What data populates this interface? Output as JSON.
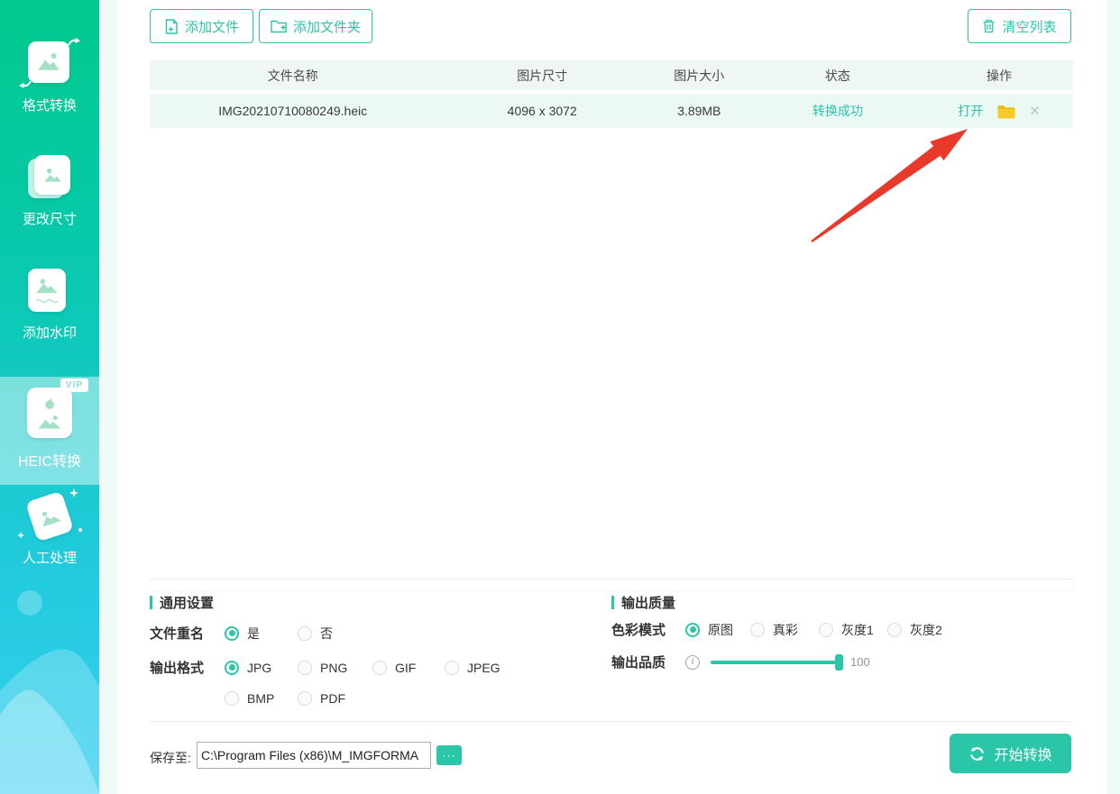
{
  "accent_color": "#2bc5a8",
  "folder_icon_color": "#f3c41f",
  "arrow_color": "#e8392b",
  "sidebar": {
    "items": [
      {
        "label": "格式转换",
        "icon": "format-convert-icon",
        "active": false
      },
      {
        "label": "更改尺寸",
        "icon": "resize-icon",
        "active": false
      },
      {
        "label": "添加水印",
        "icon": "watermark-icon",
        "active": false
      },
      {
        "label": "HEIC转换",
        "icon": "heic-convert-icon",
        "active": true,
        "badge": "VIP"
      },
      {
        "label": "人工处理",
        "icon": "manual-process-icon",
        "active": false
      }
    ]
  },
  "toolbar": {
    "add_file_label": "添加文件",
    "add_folder_label": "添加文件夹",
    "clear_list_label": "清空列表"
  },
  "table": {
    "headers": {
      "name": "文件名称",
      "dimensions": "图片尺寸",
      "size": "图片大小",
      "status": "状态",
      "operation": "操作"
    },
    "rows": [
      {
        "name": "IMG20210710080249.heic",
        "dimensions": "4096 x 3072",
        "size": "3.89MB",
        "status": "转换成功",
        "open_label": "打开"
      }
    ]
  },
  "settings": {
    "general": {
      "title": "通用设置",
      "rename_label": "文件重名",
      "rename_options": [
        {
          "label": "是",
          "selected": true
        },
        {
          "label": "否",
          "selected": false
        }
      ],
      "format_label": "输出格式",
      "format_options": [
        {
          "label": "JPG",
          "selected": true
        },
        {
          "label": "PNG",
          "selected": false
        },
        {
          "label": "GIF",
          "selected": false
        },
        {
          "label": "JPEG",
          "selected": false
        },
        {
          "label": "BMP",
          "selected": false
        },
        {
          "label": "PDF",
          "selected": false
        }
      ]
    },
    "quality": {
      "title": "输出质量",
      "color_mode_label": "色彩模式",
      "color_options": [
        {
          "label": "原图",
          "selected": true
        },
        {
          "label": "真彩",
          "selected": false
        },
        {
          "label": "灰度1",
          "selected": false
        },
        {
          "label": "灰度2",
          "selected": false
        }
      ],
      "quality_label": "输出品质",
      "quality_value": "100"
    }
  },
  "footer": {
    "save_to_label": "保存至:",
    "save_path": "C:\\Program Files (x86)\\M_IMGFORMA",
    "browse_label": "···",
    "start_label": "开始转换"
  }
}
